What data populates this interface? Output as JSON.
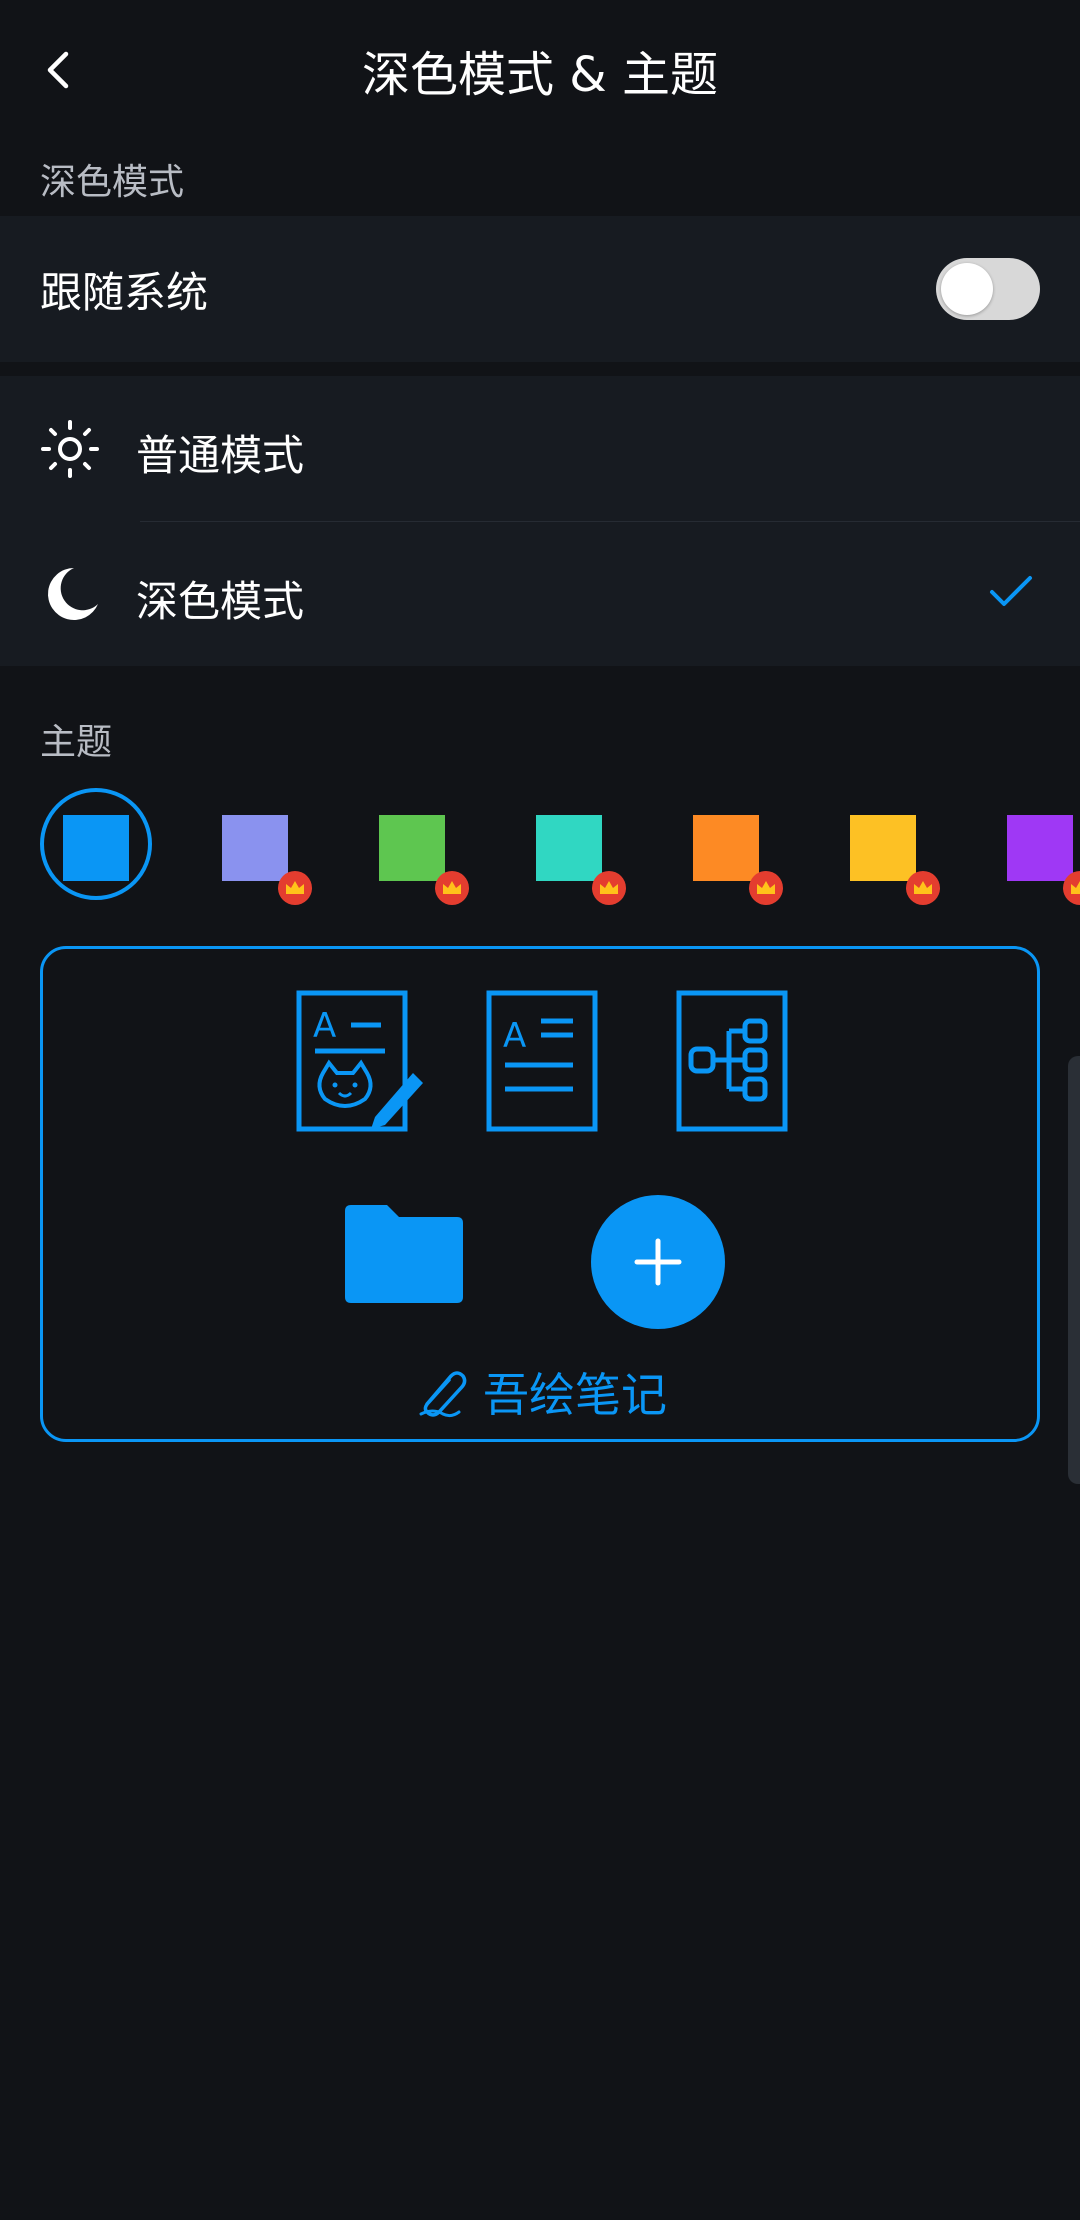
{
  "header": {
    "title": "深色模式 & 主题"
  },
  "dark_mode_section": {
    "label": "深色模式",
    "follow_system": {
      "label": "跟随系统",
      "enabled": false
    },
    "options": [
      {
        "label": "普通模式",
        "icon": "sun-icon",
        "selected": false
      },
      {
        "label": "深色模式",
        "icon": "moon-icon",
        "selected": true
      }
    ]
  },
  "theme_section": {
    "label": "主题",
    "swatches": [
      {
        "color": "#0a96f5",
        "selected": true,
        "premium": false
      },
      {
        "color": "#8a92ef",
        "selected": false,
        "premium": true
      },
      {
        "color": "#5ec650",
        "selected": false,
        "premium": true
      },
      {
        "color": "#30d7c2",
        "selected": false,
        "premium": true
      },
      {
        "color": "#fd8a24",
        "selected": false,
        "premium": true
      },
      {
        "color": "#fdc124",
        "selected": false,
        "premium": true
      },
      {
        "color": "#9f38f5",
        "selected": false,
        "premium": true
      }
    ]
  },
  "preview": {
    "icons": [
      "note-drawing-icon",
      "text-document-icon",
      "mind-map-icon",
      "folder-icon",
      "add-icon"
    ],
    "app_name": "吾绘笔记",
    "accent": "#0a96f5"
  }
}
